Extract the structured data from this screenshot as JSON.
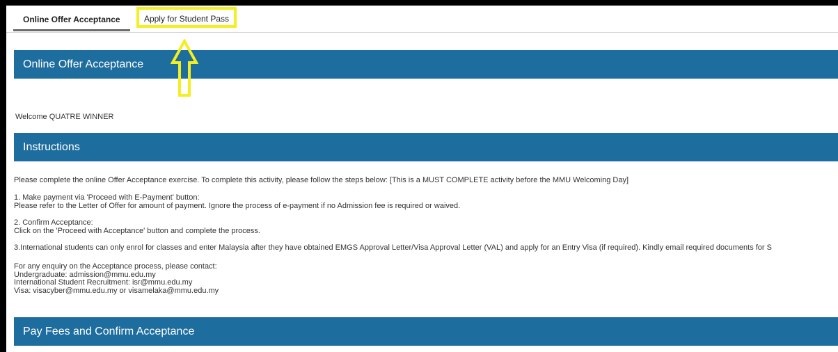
{
  "tabs": {
    "offer_acceptance": "Online Offer Acceptance",
    "student_pass": "Apply for Student Pass"
  },
  "sections": {
    "offer_title": "Online Offer Acceptance",
    "instructions_title": "Instructions",
    "pay_title": "Pay Fees and Confirm Acceptance"
  },
  "welcome": "Welcome QUATRE WINNER",
  "instructions": {
    "intro": "Please complete the online Offer Acceptance exercise. To complete this activity, please follow the steps below: [This is a MUST COMPLETE activity before the MMU Welcoming Day]",
    "step1_title": "1. Make payment via 'Proceed with E-Payment' button:",
    "step1_body": "Please refer to the Letter of Offer for amount of payment. Ignore the process of e-payment if no Admission fee is required or waived.",
    "step2_title": "2. Confirm Acceptance:",
    "step2_body": "Click on the 'Proceed with Acceptance' button and complete the process.",
    "step3": "3.International students can only enrol for classes and enter Malaysia after they have obtained EMGS Approval Letter/Visa Approval Letter (VAL) and apply for an Entry Visa (if required). Kindly email required documents for S",
    "contact_intro": "For any enquiry on the Acceptance process, please contact:",
    "contact_ug": "Undergraduate: admission@mmu.edu.my",
    "contact_isr": "International Student Recruitment: isr@mmu.edu.my",
    "contact_visa": "Visa: visacyber@mmu.edu.my or visamelaka@mmu.edu.my"
  },
  "colors": {
    "section_bar": "#1e6d9f",
    "highlight": "#f5ee22"
  },
  "icons": {
    "annotation": "up-arrow-icon"
  }
}
